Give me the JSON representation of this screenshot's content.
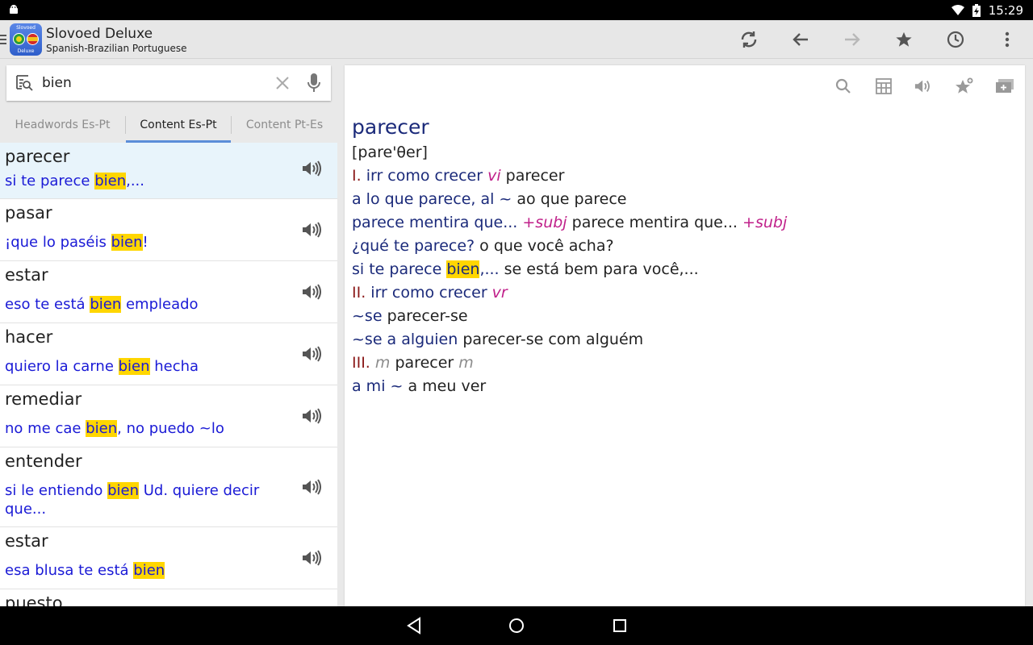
{
  "status_bar": {
    "time": "15:29"
  },
  "app_bar": {
    "logo": {
      "top_text": "Slovoed",
      "bottom_text": "Deluxe"
    },
    "title": "Slovoed Deluxe",
    "subtitle": "Spanish-Brazilian Portuguese",
    "actions": [
      "sync-icon",
      "back-arrow-icon",
      "forward-arrow-icon",
      "star-icon",
      "history-icon",
      "overflow-menu-icon"
    ]
  },
  "search": {
    "value": "bien",
    "placeholder": ""
  },
  "tabs": [
    {
      "label": "Headwords Es-Pt",
      "active": false
    },
    {
      "label": "Content Es-Pt",
      "active": true
    },
    {
      "label": "Content Pt-Es",
      "active": false
    }
  ],
  "results": [
    {
      "headword": "parecer",
      "pre": "si te parece ",
      "match": "bien",
      "post": ",..."
    },
    {
      "headword": "pasar",
      "pre": "¡que lo paséis ",
      "match": "bien",
      "post": "!"
    },
    {
      "headword": "estar",
      "pre": "eso te está ",
      "match": "bien",
      "post": " empleado"
    },
    {
      "headword": "hacer",
      "pre": "quiero la carne ",
      "match": "bien",
      "post": " hecha"
    },
    {
      "headword": "remediar",
      "pre": "no me cae ",
      "match": "bien",
      "post": ", no puedo ~lo"
    },
    {
      "headword": "entender",
      "pre": "si le entiendo ",
      "match": "bien",
      "post": " Ud. quiere decir que..."
    },
    {
      "headword": "estar",
      "pre": "esa blusa te está ",
      "match": "bien",
      "post": ""
    },
    {
      "headword": "puesto",
      "pre": "",
      "match": "",
      "post": ""
    }
  ],
  "entry": {
    "headword": "parecer",
    "transcription": "[pare'θer]",
    "lines": [
      {
        "roman": "I.",
        "bold": "irr como crecer",
        "gram": "vi",
        "text": "parecer"
      },
      {
        "bold": "a lo que parece, al ~",
        "text": "ao que parece"
      },
      {
        "bold": "parece mentira que...",
        "gram": "+subj",
        "text": "parece mentira que...",
        "gram2": "+subj"
      },
      {
        "bold": "¿qué te parece?",
        "text": "o que você acha?"
      },
      {
        "bold_pre": "si te parece ",
        "bold_match": "bien",
        "bold_post": ",...",
        "text": "se está bem para você,..."
      },
      {
        "roman": "II.",
        "bold": "irr como crecer",
        "gram": "vr"
      },
      {
        "bold": "~se",
        "text": "parecer-se"
      },
      {
        "bold": "~se a alguien",
        "text": "parecer-se com alguém"
      },
      {
        "roman": "III.",
        "grey": "m",
        "text": "parecer",
        "grey2": "m"
      },
      {
        "bold": "a mi ~",
        "text": "a meu ver"
      }
    ]
  }
}
